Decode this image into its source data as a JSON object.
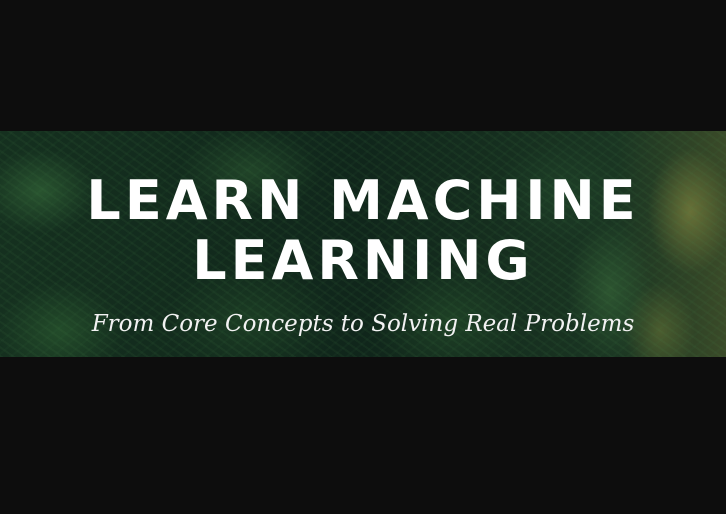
{
  "banner": {
    "title_line1": "LEARN MACHINE",
    "title_line2": "LEARNING",
    "subtitle": "From Core Concepts to Solving Real Problems"
  }
}
